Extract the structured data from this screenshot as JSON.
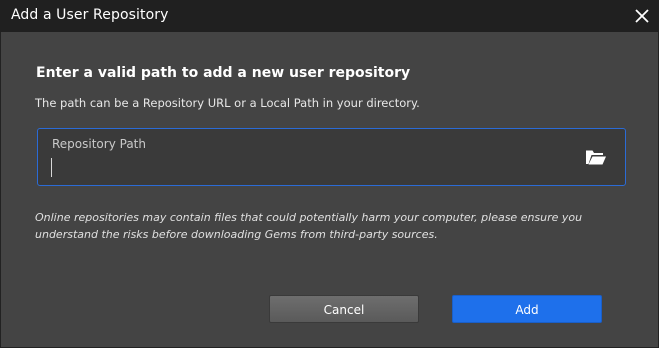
{
  "window": {
    "title": "Add a User Repository",
    "close_icon": "close-icon"
  },
  "content": {
    "heading": "Enter a valid path to add a new user repository",
    "description": "The path can be a Repository URL or a Local Path in your directory.",
    "path_field": {
      "label": "Repository Path",
      "value": "",
      "browse_icon": "folder-open-icon",
      "focus_color": "#2b6bd6"
    },
    "warning": "Online repositories may contain files that could potentially harm your computer, please ensure you understand the risks before downloading Gems from third-party sources."
  },
  "buttons": {
    "cancel_label": "Cancel",
    "add_label": "Add",
    "add_color": "#1e70eb"
  }
}
